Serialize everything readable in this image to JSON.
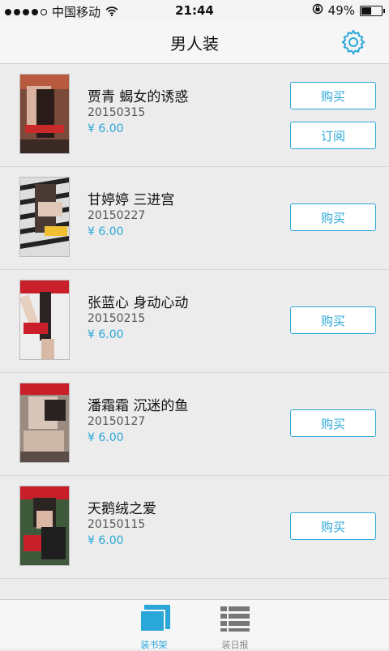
{
  "status": {
    "carrier": "中国移动",
    "time": "21:44",
    "battery": "49%"
  },
  "nav": {
    "title": "男人装"
  },
  "items": [
    {
      "name": "贾青 蝎女的诱惑",
      "date": "20150315",
      "price": "¥ 6.00",
      "buy": "购买",
      "subscribe": "订阅"
    },
    {
      "name": "甘婷婷 三进宫",
      "date": "20150227",
      "price": "¥ 6.00",
      "buy": "购买"
    },
    {
      "name": "张蓝心 身动心动",
      "date": "20150215",
      "price": "¥ 6.00",
      "buy": "购买"
    },
    {
      "name": "潘霜霜 沉迷的鱼",
      "date": "20150127",
      "price": "¥ 6.00",
      "buy": "购买"
    },
    {
      "name": "天鹅绒之爱",
      "date": "20150115",
      "price": "¥ 6.00",
      "buy": "购买"
    }
  ],
  "tabs": [
    {
      "label": "装书架"
    },
    {
      "label": "装日报"
    }
  ],
  "colors": {
    "accent": "#2aa7d9",
    "background": "#ececec"
  }
}
